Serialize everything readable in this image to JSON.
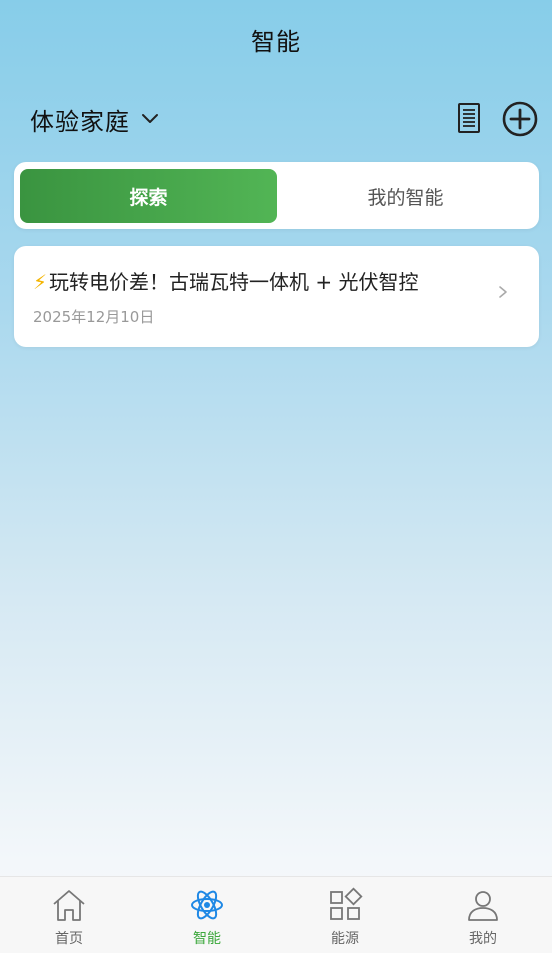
{
  "header": {
    "title": "智能"
  },
  "home": {
    "name": "体验家庭"
  },
  "icons": {
    "dropdown": "chevron-down-icon",
    "doc": "document-list-icon",
    "add": "plus-circle-icon",
    "arrow": "chevron-right-icon"
  },
  "tabs": [
    {
      "label": "探索",
      "active": true
    },
    {
      "label": "我的智能",
      "active": false
    }
  ],
  "cards": [
    {
      "icon": "⚡",
      "title": "玩转电价差！古瑞瓦特一体机 + 光伏智控",
      "date": "2025年12月10日"
    }
  ],
  "nav": [
    {
      "label": "首页",
      "icon": "home-icon",
      "active": false
    },
    {
      "label": "智能",
      "icon": "atom-icon",
      "active": true
    },
    {
      "label": "能源",
      "icon": "grid-icon",
      "active": false
    },
    {
      "label": "我的",
      "icon": "user-icon",
      "active": false
    }
  ],
  "colors": {
    "accent": "#3ca83c",
    "tab_gradient_start": "#3a9440",
    "tab_gradient_end": "#52b555",
    "atom_blue": "#1e88e5"
  }
}
